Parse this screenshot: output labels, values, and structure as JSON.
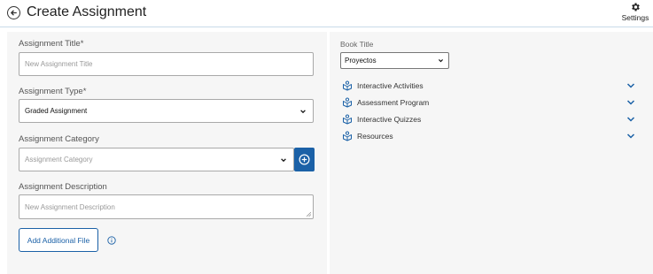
{
  "header": {
    "title": "Create Assignment",
    "settings_label": "Settings"
  },
  "form": {
    "title_label": "Assignment Title*",
    "title_placeholder": "New Assignment Title",
    "type_label": "Assignment Type*",
    "type_value": "Graded Assignment",
    "category_label": "Assignment Category",
    "category_placeholder": "Assignment Category",
    "description_label": "Assignment Description",
    "description_placeholder": "New Assignment Description",
    "add_file_label": "Add Additional File"
  },
  "book": {
    "label": "Book Title",
    "selected": "Proyectos"
  },
  "resources": [
    {
      "label": "Interactive Activities"
    },
    {
      "label": "Assessment Program"
    },
    {
      "label": "Interactive Quizzes"
    },
    {
      "label": "Resources"
    }
  ],
  "colors": {
    "accent": "#1b61a7",
    "panel_bg": "#f6f6f6",
    "header_border": "#c9dbe9"
  },
  "icons": {
    "back": "back-arrow-circle-icon",
    "settings": "gear-icon",
    "add_category": "plus-circle-icon",
    "info": "info-icon",
    "resource": "package-icon",
    "expand": "chevron-down-icon"
  }
}
